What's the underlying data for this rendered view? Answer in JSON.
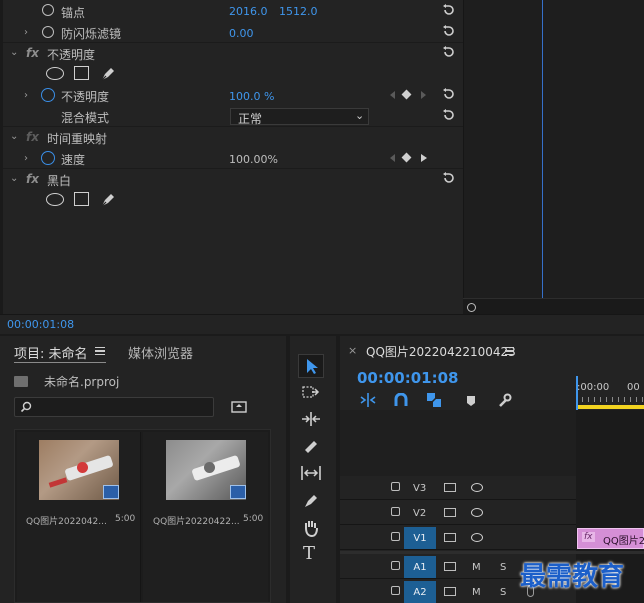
{
  "effect_controls": {
    "anchor": {
      "label": "锚点",
      "x": "2016.0",
      "y": "1512.0"
    },
    "anti_flicker": {
      "label": "防闪烁滤镜",
      "value": "0.00"
    },
    "opacity_group": {
      "label": "不透明度"
    },
    "opacity": {
      "label": "不透明度",
      "value": "100.0 %"
    },
    "blend_mode": {
      "label": "混合模式",
      "value": "正常"
    },
    "time_remap": {
      "label": "时间重映射"
    },
    "speed": {
      "label": "速度",
      "value": "100.00%"
    },
    "black_white": {
      "label": "黑白"
    },
    "timecode": "00:00:01:08"
  },
  "project_panel": {
    "tab_project": "项目: 未命名",
    "tab_media": "媒体浏览器",
    "project_file": "未命名.prproj",
    "search_placeholder": "",
    "items": [
      {
        "name": "QQ图片2022042...",
        "duration": "5:00"
      },
      {
        "name": "QQ图片20220422...",
        "duration": "5:00"
      }
    ]
  },
  "timeline": {
    "close": "×",
    "sequence_name": "QQ图片20220422100423",
    "timecode": "00:00:01:08",
    "ruler": [
      ":00:00",
      "00"
    ],
    "tracks": [
      {
        "id": "V3",
        "type": "video"
      },
      {
        "id": "V2",
        "type": "video"
      },
      {
        "id": "V1",
        "type": "video",
        "active": true
      },
      {
        "id": "A1",
        "type": "audio",
        "active": true,
        "m": "M",
        "s": "S"
      },
      {
        "id": "A2",
        "type": "audio",
        "active": true,
        "m": "M",
        "s": "S"
      }
    ],
    "clip_label": "QQ图片2",
    "clip_fx": "fx"
  },
  "watermark": "最需教育",
  "colors": {
    "accent": "#3f96ec",
    "clip": "#d58fd6",
    "playhead": "#f2d320"
  }
}
